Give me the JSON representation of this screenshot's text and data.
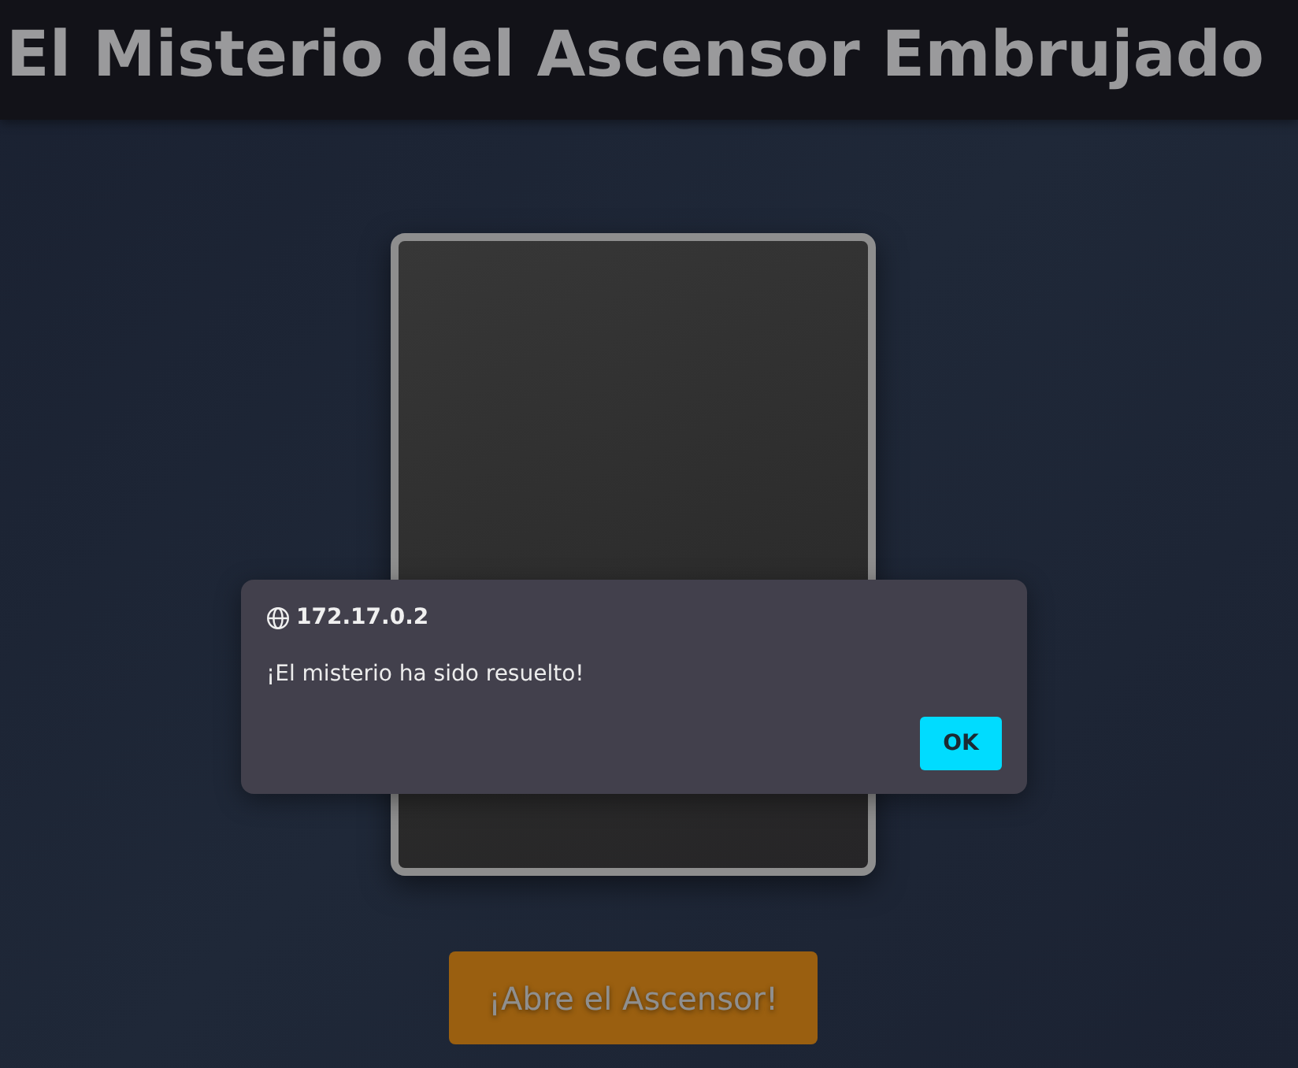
{
  "header": {
    "title": "El Misterio del Ascensor Embrujado"
  },
  "open_button": {
    "label": "¡Abre el Ascensor!"
  },
  "dialog": {
    "origin": "172.17.0.2",
    "message": "¡El misterio ha sido resuelto!",
    "buttons": [
      "OK"
    ]
  }
}
